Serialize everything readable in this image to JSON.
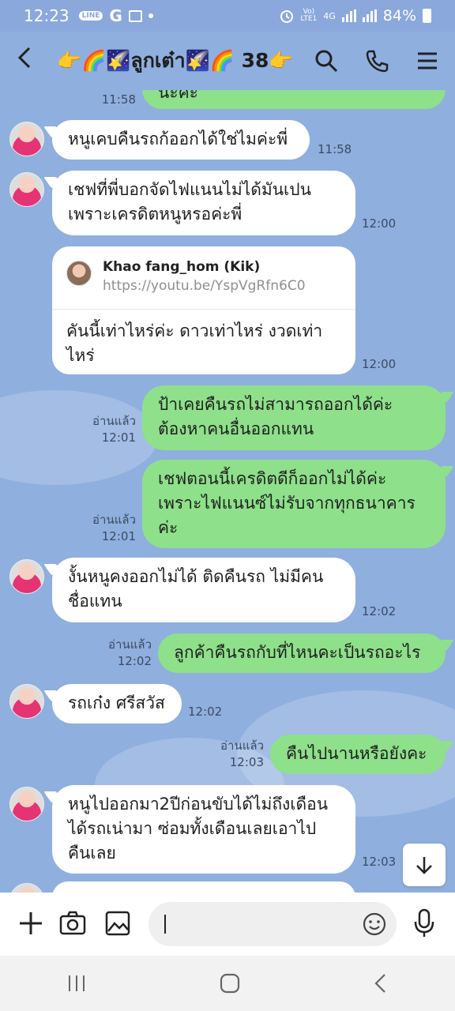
{
  "status_bar": {
    "time": "12:23",
    "network_top": "Vo)",
    "network_bottom": "LTE1",
    "network_type": "4G",
    "battery": "84%"
  },
  "header": {
    "title": "👉🌈🌠ลูกเต๋า🌠🌈 38👉"
  },
  "messages": [
    {
      "side": "out",
      "text": "นะคะ",
      "time": "11:58"
    },
    {
      "side": "in",
      "text": "หนูเคบคืนรถก้ออกได้ใช่ไมค่ะพี่",
      "time": "11:58"
    },
    {
      "side": "in",
      "text": "เชฟที่พี่บอกจัดไฟแนนไม่ได้มันเปน\nเพราะเครดิตหนูหรอค่ะพี่",
      "time": "12:00"
    },
    {
      "side": "in",
      "type": "link",
      "name": "Khao fang_hom (Kik)",
      "url": "https://youtu.be/YspVgRfn6C0",
      "text": "คันนี้เท่าไหร่ค่ะ ดาวเท่าไหร่ งวดเท่า\nไหร่",
      "time": "12:00"
    },
    {
      "side": "out",
      "text": "ป้าเคยคืนรถไม่สามารถออกได้ค่ะ\nต้องหาคนอื่นออกแทน",
      "read": "อ่านแล้ว",
      "time": "12:01"
    },
    {
      "side": "out",
      "text": "เชฟตอนนี้เครดิตดีก็ออกไม่ได้ค่ะ\nเพราะไฟแนนซ์ไม่รับจากทุกธนาคาร\nค่ะ",
      "read": "อ่านแล้ว",
      "time": "12:01"
    },
    {
      "side": "in",
      "text": "งั้นหนูคงออกไม่ได้ ติดคืนรถ ไม่มีคน\nชื่อแทน",
      "time": "12:02"
    },
    {
      "side": "out",
      "text": "ลูกค้าคืนรถกับที่ไหนคะเป็นรถอะไร",
      "read": "อ่านแล้ว",
      "time": "12:02"
    },
    {
      "side": "in",
      "text": "รถเก๋ง ศรีสวัส",
      "time": "12:02"
    },
    {
      "side": "out",
      "text": "คืนไปนานหรือยังคะ",
      "read": "อ่านแล้ว",
      "time": "12:03"
    },
    {
      "side": "in",
      "text": "หนูไปออกมา2ปีก่อนขับได้ไม่ถึงเดือน\nได้รถเน่ามา ซ่อมทั้งเดือนเลยเอาไป\nคืนเลย",
      "time": "12:03"
    }
  ],
  "colors": {
    "background": "#8fafde",
    "outgoing_bubble": "#8ee08a",
    "incoming_bubble": "#ffffff"
  },
  "icons": {
    "status": [
      "line-icon",
      "g-icon",
      "gallery-icon",
      "alarm-icon",
      "signal-icon",
      "battery-icon"
    ],
    "header": [
      "back-icon",
      "search-icon",
      "phone-icon",
      "menu-icon"
    ],
    "input": [
      "plus-icon",
      "camera-icon",
      "image-icon",
      "emoji-icon",
      "mic-icon"
    ],
    "nav": [
      "recents-icon",
      "home-icon",
      "back-nav-icon"
    ]
  }
}
